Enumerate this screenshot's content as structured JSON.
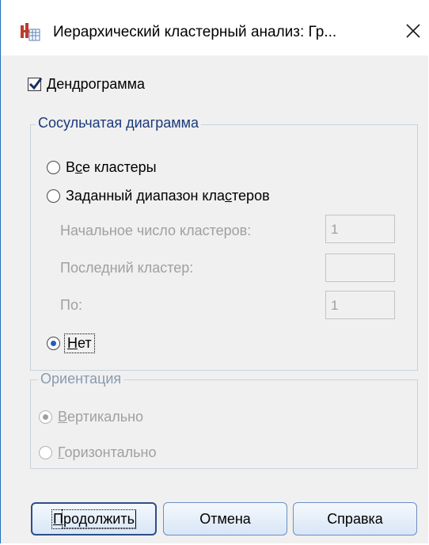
{
  "window": {
    "title": "Иерархический кластерный анализ: Гр...",
    "close_glyph": "✕"
  },
  "dendrogram": {
    "label": "Дендрограмма",
    "checked": true
  },
  "icicle": {
    "legend": "Сосульчатая диаграмма",
    "all_clusters": {
      "pre": "В",
      "u": "с",
      "post": "е кластеры",
      "selected": false
    },
    "range": {
      "pre": "Заданный диапазон кла",
      "u": "с",
      "post": "теров",
      "selected": false
    },
    "start_label": "Начальное число кластеров:",
    "start_value": "1",
    "last_label": "Последний кластер:",
    "last_value": "",
    "by_label": "По:",
    "by_value": "1",
    "none": {
      "u": "Н",
      "post": "ет",
      "selected": true
    }
  },
  "orientation": {
    "legend": "Ориентация",
    "vertical": {
      "u": "В",
      "post": "ертикально",
      "selected": true
    },
    "horizontal": {
      "u": "Г",
      "post": "оризонтально",
      "selected": false
    }
  },
  "buttons": {
    "continue": {
      "u": "П",
      "post": "родолжить"
    },
    "cancel": "Отмена",
    "help": "Справка"
  },
  "colors": {
    "accent": "#1e5fbf",
    "disabled_text": "#a0a0a0",
    "group_legend": "#1a3a7a"
  }
}
